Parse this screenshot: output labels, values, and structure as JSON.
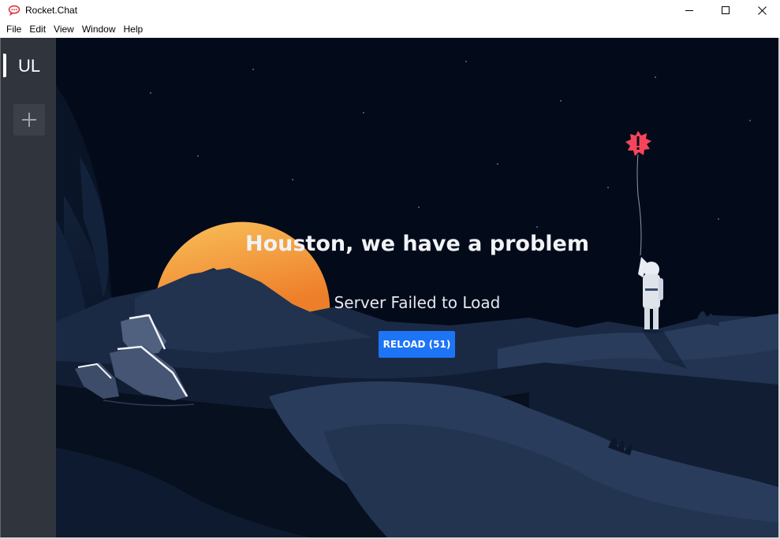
{
  "window": {
    "title": "Rocket.Chat",
    "icon": "rocket-chat-logo",
    "controls": [
      "minimize",
      "maximize",
      "close"
    ]
  },
  "menu": [
    "File",
    "Edit",
    "View",
    "Window",
    "Help"
  ],
  "sidebar": {
    "servers": [
      {
        "label": "UL",
        "active": true
      }
    ],
    "add_server_icon": "plus-icon"
  },
  "error_page": {
    "title": "Houston, we have a problem",
    "subtitle": "Server Failed to Load",
    "reload_label": "RELOAD (51)"
  },
  "colors": {
    "sky": "#030b1b",
    "sidebar": "#2f343d",
    "accent": "#1d74f5",
    "sun_top": "#f9c05a",
    "sun_bottom": "#ee7f2a",
    "alert_balloon": "#f5455c"
  }
}
